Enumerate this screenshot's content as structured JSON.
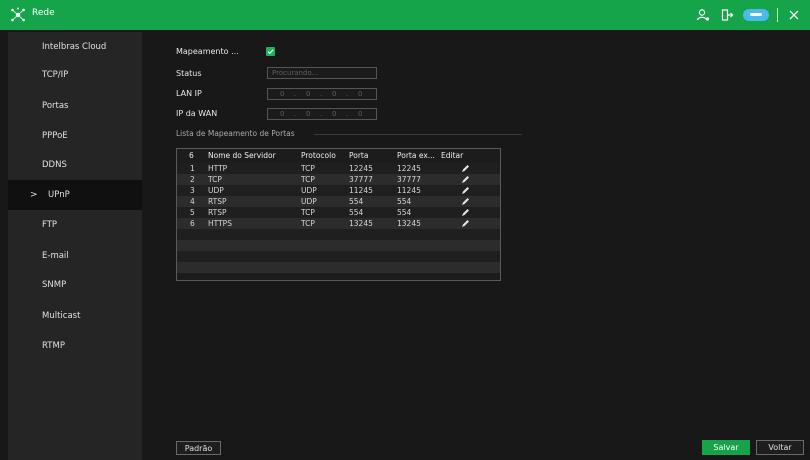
{
  "app": {
    "title": "Rede"
  },
  "sidebar": {
    "items": [
      {
        "label": "Intelbras Cloud",
        "active": false
      },
      {
        "label": "TCP/IP",
        "active": false
      },
      {
        "label": "Portas",
        "active": false
      },
      {
        "label": "PPPoE",
        "active": false
      },
      {
        "label": "DDNS",
        "active": false
      },
      {
        "label": "UPnP",
        "active": true
      },
      {
        "label": "FTP",
        "active": false
      },
      {
        "label": "E-mail",
        "active": false
      },
      {
        "label": "SNMP",
        "active": false
      },
      {
        "label": "Multicast",
        "active": false
      },
      {
        "label": "RTMP",
        "active": false
      }
    ],
    "active_chevron": ">"
  },
  "form": {
    "mapping_label": "Mapeamento ...",
    "mapping_checked": true,
    "status_label": "Status",
    "status_placeholder": "Procurando...",
    "lan_ip_label": "LAN IP",
    "lan_ip": [
      "0",
      "0",
      "0",
      "0"
    ],
    "wan_ip_label": "IP da WAN",
    "wan_ip": [
      "0",
      "0",
      "0",
      "0"
    ],
    "ip_separator": "."
  },
  "table": {
    "section_title": "Lista de Mapeamento de Portas",
    "headers": {
      "count": "6",
      "name": "Nome do Servidor",
      "protocol": "Protocolo",
      "port": "Porta",
      "external_port": "Porta ex...",
      "edit": "Editar"
    },
    "rows": [
      {
        "n": "1",
        "name": "HTTP",
        "protocol": "TCP",
        "port": "12245",
        "ext": "12245"
      },
      {
        "n": "2",
        "name": "TCP",
        "protocol": "TCP",
        "port": "37777",
        "ext": "37777"
      },
      {
        "n": "3",
        "name": "UDP",
        "protocol": "UDP",
        "port": "11245",
        "ext": "11245"
      },
      {
        "n": "4",
        "name": "RTSP",
        "protocol": "UDP",
        "port": "554",
        "ext": "554"
      },
      {
        "n": "5",
        "name": "RTSP",
        "protocol": "TCP",
        "port": "554",
        "ext": "554"
      },
      {
        "n": "6",
        "name": "HTTPS",
        "protocol": "TCP",
        "port": "13245",
        "ext": "13245"
      }
    ]
  },
  "buttons": {
    "default": "Padrão",
    "save": "Salvar",
    "back": "Voltar"
  },
  "icons": {
    "title": "network-icon",
    "user": "user-icon",
    "logout": "logout-icon",
    "cloud": "cloud-icon",
    "close": "close-icon"
  },
  "colors": {
    "accent": "#16a44a",
    "cloud": "#4ab9ec"
  }
}
